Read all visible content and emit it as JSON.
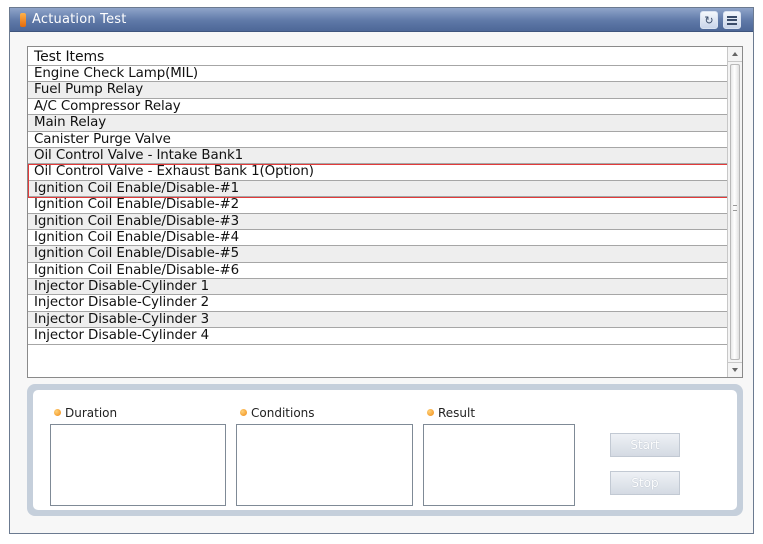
{
  "window": {
    "title": "Actuation Test",
    "retry_icon": "retry-icon",
    "menu_icon": "menu-icon"
  },
  "list": {
    "header": "Test Items",
    "items": [
      "Engine Check Lamp(MIL)",
      "Fuel Pump Relay",
      "A/C Compressor Relay",
      "Main Relay",
      "Canister Purge Valve",
      "Oil Control Valve - Intake Bank1",
      "Oil Control Valve - Exhaust Bank 1(Option)",
      "Ignition Coil Enable/Disable-#1",
      "Ignition Coil Enable/Disable-#2",
      "Ignition Coil Enable/Disable-#3",
      "Ignition Coil Enable/Disable-#4",
      "Ignition Coil Enable/Disable-#5",
      "Ignition Coil Enable/Disable-#6",
      "Injector Disable-Cylinder 1",
      "Injector Disable-Cylinder 2",
      "Injector Disable-Cylinder 3",
      "Injector Disable-Cylinder 4"
    ],
    "highlight_color": "#e23a3a"
  },
  "panel": {
    "duration_label": "Duration",
    "conditions_label": "Conditions",
    "result_label": "Result",
    "start_label": "Start",
    "stop_label": "Stop",
    "bullet_color": "#f08a14"
  }
}
